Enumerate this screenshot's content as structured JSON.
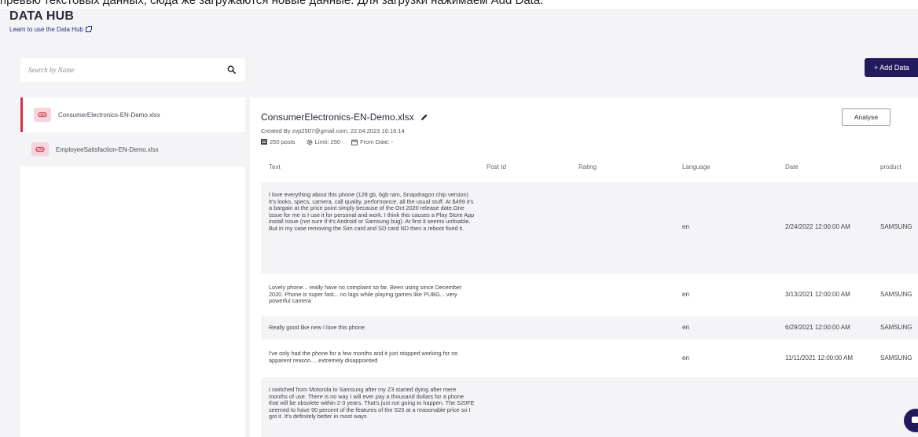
{
  "banner": "превью текстовых данных, сюда же загружаются новые данные. Для загрузки нажимаем Add Data.",
  "header": {
    "title": "DATA HUB",
    "learn_link": "Learn to use the Data Hub"
  },
  "search": {
    "placeholder": "Search by Name"
  },
  "add_button": "+ Add Data",
  "files": [
    {
      "name": "ConsumerElectronics-EN-Demo.xlsx"
    },
    {
      "name": "EmployeeSatisfaction-EN-Demo.xlsx"
    }
  ],
  "detail": {
    "title": "ConsumerElectronics-EN-Demo.xlsx",
    "created": "Created By zvp2507@gmail.com, 22.04.2023 16:16:14",
    "posts": "250 posts",
    "limit": "Limit: 250",
    "from_date": "From Date: -",
    "analyse": "Analyse"
  },
  "table": {
    "columns": [
      "Text",
      "Post Id",
      "Rating",
      "Language",
      "Date",
      "product"
    ],
    "rows": [
      {
        "text": "I love everything about this phone (128 gb, 6gb ram, Snapdragon chip version) It's looks, specs, camera, call quality, performance, all the usual stuff. At $499 it's a bargain at the price point simply because of the Oct 2020 release date.One issue for me is I use it for personal and work. I think this causes a Play Store App install issue (not sure if it's Android or Samsung bug). At first it seems unfixable. But in my case removing the Sim card and SD card ND then a reboot fixed it.",
        "language": "en",
        "date": "2/24/2022 12:00:00 AM",
        "product": "SAMSUNG"
      },
      {
        "text": "Lovely phone... really have no complaint so far. Been using since December 2020. Phone is super fast... no lags while playing games like PUBG... very powerful camera",
        "language": "en",
        "date": "3/13/2021 12:00:00 AM",
        "product": "SAMSUNG"
      },
      {
        "text": "Really good like new I love this phone",
        "language": "en",
        "date": "6/29/2021 12:00:00 AM",
        "product": "SAMSUNG"
      },
      {
        "text": "I've only had the phone for a few months and it just stopped working for no apparent reason.....extremely disappointed",
        "language": "en",
        "date": "11/11/2021 12:00:00 AM",
        "product": "SAMSUNG"
      },
      {
        "text": "I switched from Motorola to Samsung after my Z3 started dying after mere months of use. There is no way I will ever pay a thousand dollars for a phone that will be obsolete within 2-3 years. That's just not going to happen. The S20FE seemed to have 90 percent of the features of the S20 at a reasonable price so I got it. It's definitely better in most ways",
        "language": "",
        "date": "",
        "product": ""
      }
    ]
  }
}
